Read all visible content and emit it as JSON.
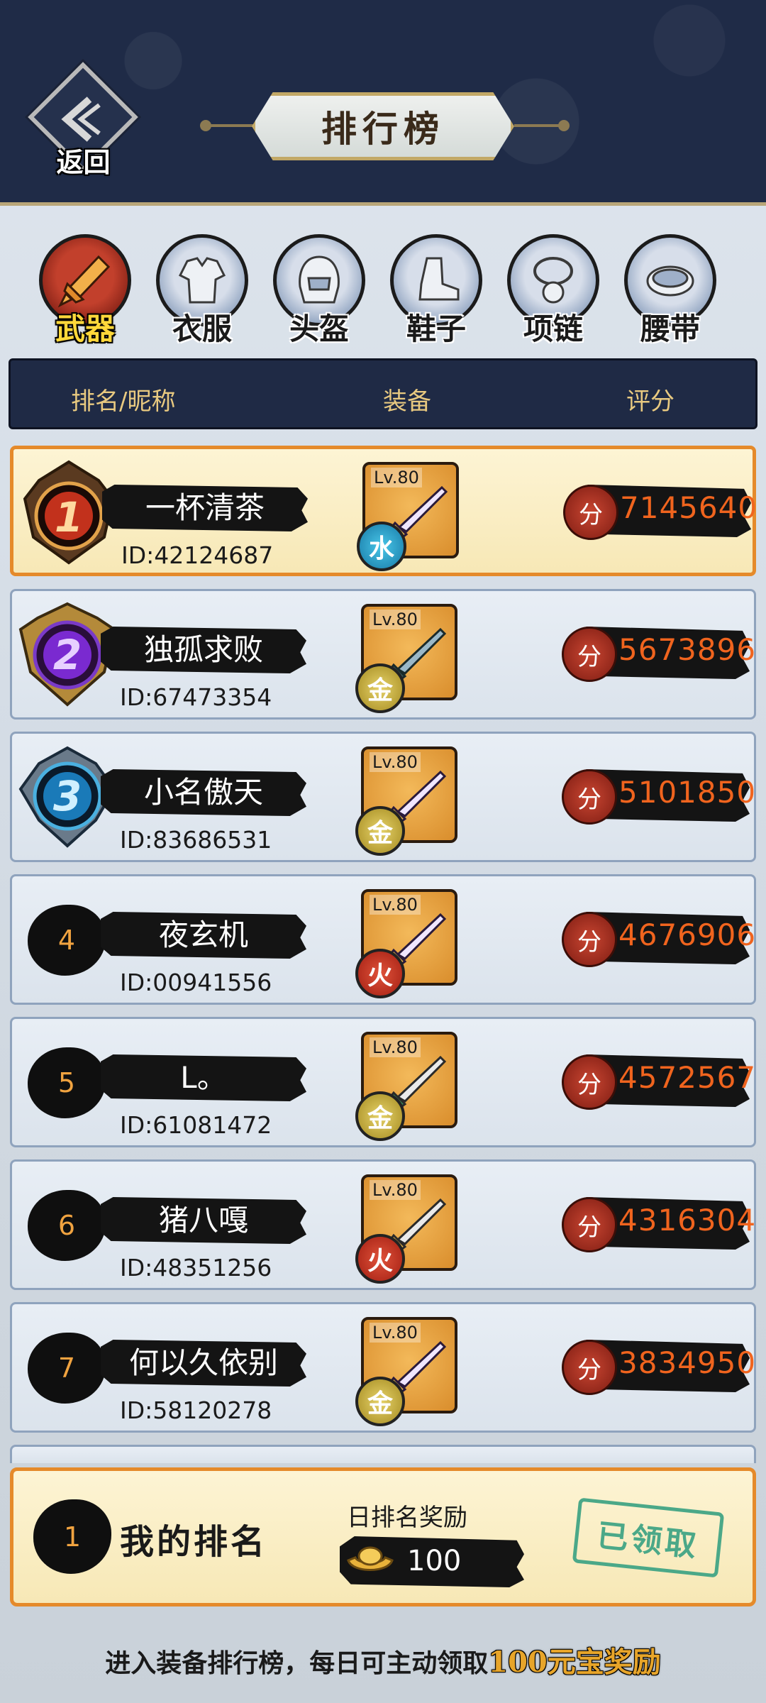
{
  "header": {
    "back_label": "返回",
    "title": "排行榜"
  },
  "tabs": [
    {
      "label": "武器",
      "icon": "weapon-icon",
      "active": true
    },
    {
      "label": "衣服",
      "icon": "clothes-icon",
      "active": false
    },
    {
      "label": "头盔",
      "icon": "helmet-icon",
      "active": false
    },
    {
      "label": "鞋子",
      "icon": "shoes-icon",
      "active": false
    },
    {
      "label": "项链",
      "icon": "necklace-icon",
      "active": false
    },
    {
      "label": "腰带",
      "icon": "belt-icon",
      "active": false
    }
  ],
  "columns": {
    "rank_name": "排名/昵称",
    "equipment": "装备",
    "score": "评分"
  },
  "score_icon_label": "分",
  "rows": [
    {
      "rank": "1",
      "name": "一杯清茶",
      "id": "ID:42124687",
      "level": "Lv.80",
      "element": "水",
      "score": "7145640"
    },
    {
      "rank": "2",
      "name": "独孤求败",
      "id": "ID:67473354",
      "level": "Lv.80",
      "element": "金",
      "score": "5673896"
    },
    {
      "rank": "3",
      "name": "小名傲天",
      "id": "ID:83686531",
      "level": "Lv.80",
      "element": "金",
      "score": "5101850"
    },
    {
      "rank": "4",
      "name": "夜玄机",
      "id": "ID:00941556",
      "level": "Lv.80",
      "element": "火",
      "score": "4676906"
    },
    {
      "rank": "5",
      "name": "L。",
      "id": "ID:61081472",
      "level": "Lv.80",
      "element": "金",
      "score": "4572567"
    },
    {
      "rank": "6",
      "name": "猪八嘎",
      "id": "ID:48351256",
      "level": "Lv.80",
      "element": "火",
      "score": "4316304"
    },
    {
      "rank": "7",
      "name": "何以久依别",
      "id": "ID:58120278",
      "level": "Lv.80",
      "element": "金",
      "score": "3834950"
    }
  ],
  "my_rank": {
    "rank": "1",
    "label": "我的排名",
    "reward_title": "日排名奖励",
    "reward_amount": "100",
    "claimed_label": "已领取"
  },
  "footer": {
    "text": "进入装备排行榜，每日可主动领取",
    "highlight": "100元宝奖励"
  }
}
